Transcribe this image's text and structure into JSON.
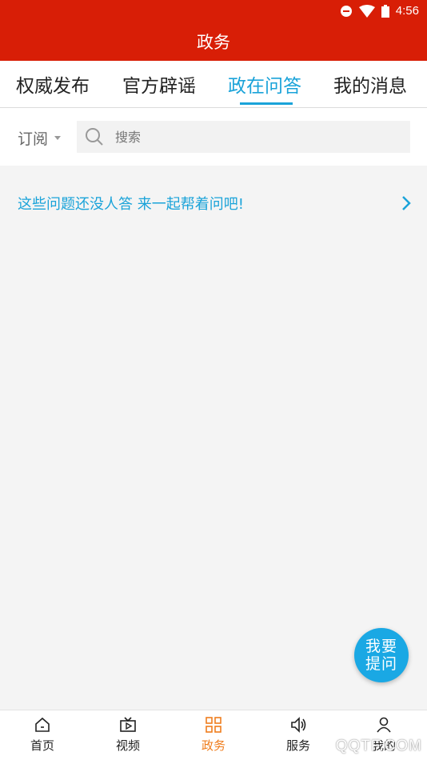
{
  "status_bar": {
    "time": "4:56"
  },
  "header": {
    "title": "政务"
  },
  "tabs": [
    {
      "label": "权威发布",
      "active": false
    },
    {
      "label": "官方辟谣",
      "active": false
    },
    {
      "label": "政在问答",
      "active": true
    },
    {
      "label": "我的消息",
      "active": false
    }
  ],
  "filter": {
    "subscribe_label": "订阅",
    "search_placeholder": "搜索"
  },
  "prompt": {
    "text": "这些问题还没人答 来一起帮着问吧!"
  },
  "fab": {
    "label": "我要提问"
  },
  "bottom_nav": [
    {
      "label": "首页",
      "icon": "home-icon",
      "active": false
    },
    {
      "label": "视频",
      "icon": "video-icon",
      "active": false
    },
    {
      "label": "政务",
      "icon": "grid-icon",
      "active": true
    },
    {
      "label": "服务",
      "icon": "speaker-icon",
      "active": false
    },
    {
      "label": "我的",
      "icon": "user-icon",
      "active": false
    }
  ],
  "watermark": "QQTF.COM",
  "colors": {
    "brand_red": "#d81e06",
    "accent_blue": "#1aa3d9",
    "nav_active": "#ef7d1d"
  }
}
